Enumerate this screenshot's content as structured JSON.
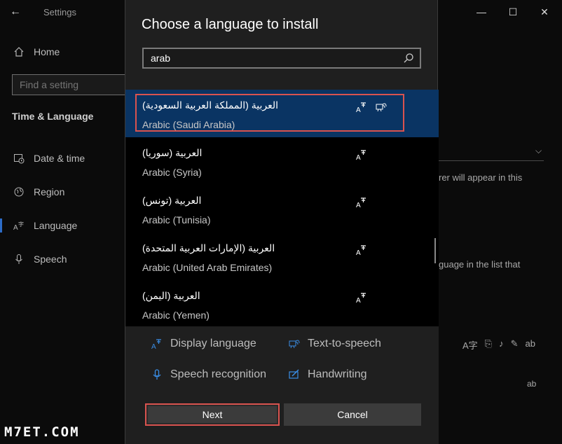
{
  "window": {
    "app_title": "Settings",
    "back_icon": "back-arrow-icon",
    "controls": {
      "minimize": "—",
      "maximize": "☐",
      "close": "✕"
    }
  },
  "sidebar": {
    "home_label": "Home",
    "find_placeholder": "Find a setting",
    "section_title": "Time & Language",
    "items": [
      {
        "label": "Date & time",
        "icon": "calendar-clock-icon"
      },
      {
        "label": "Region",
        "icon": "globe-icon"
      },
      {
        "label": "Language",
        "icon": "language-icon",
        "active": true
      },
      {
        "label": "Speech",
        "icon": "microphone-icon"
      }
    ]
  },
  "background_text": {
    "fragment1": "rer will appear in this",
    "fragment2": "guage in the list that"
  },
  "dialog": {
    "title": "Choose a language to install",
    "search_value": "arab",
    "languages": [
      {
        "native": "العربية (المملكة العربية السعودية)",
        "english": "Arabic (Saudi Arabia)",
        "selected": true,
        "features": [
          "display-language",
          "text-to-speech"
        ]
      },
      {
        "native": "العربية (سوريا)",
        "english": "Arabic (Syria)",
        "selected": false,
        "features": [
          "display-language"
        ]
      },
      {
        "native": "العربية (تونس)",
        "english": "Arabic (Tunisia)",
        "selected": false,
        "features": [
          "display-language"
        ]
      },
      {
        "native": "العربية (الإمارات العربية المتحدة)",
        "english": "Arabic (United Arab Emirates)",
        "selected": false,
        "features": [
          "display-language"
        ]
      },
      {
        "native": "العربية (اليمن)",
        "english": "Arabic (Yemen)",
        "selected": false,
        "features": [
          "display-language"
        ]
      }
    ],
    "legend": {
      "display_language": "Display language",
      "text_to_speech": "Text-to-speech",
      "speech_recognition": "Speech recognition",
      "handwriting": "Handwriting"
    },
    "buttons": {
      "next": "Next",
      "cancel": "Cancel"
    }
  },
  "watermark": "M7ET.COM",
  "colors": {
    "accent_blue": "#0a3463",
    "highlight_red": "#d9534f",
    "icon_blue": "#3a8ee6"
  }
}
